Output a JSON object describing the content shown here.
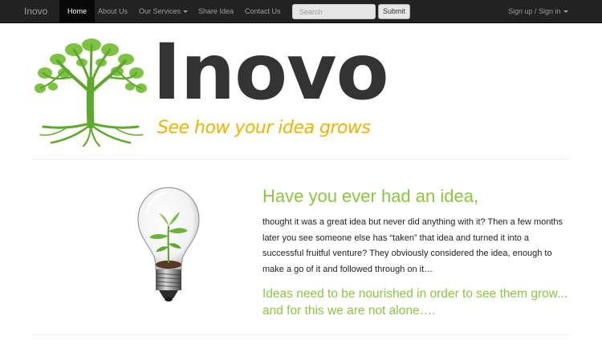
{
  "navbar": {
    "brand": "Inovo",
    "items": [
      {
        "label": "Home"
      },
      {
        "label": "About Us"
      },
      {
        "label": "Our Services"
      },
      {
        "label": "Share Idea"
      },
      {
        "label": "Contact Us"
      }
    ],
    "search_placeholder": "Search",
    "submit_label": "Submit",
    "signin_label": "Sign up / Sign in"
  },
  "hero": {
    "logo_text": "Inovo",
    "tagline": "See how your idea grows"
  },
  "main": {
    "heading": "Have you ever had an idea,",
    "paragraph": "thought it was a great idea but never did anything with it? Then a few months later you see someone else has “taken” that idea and turned it into a successful fruitful venture? They obviously considered the idea, enough to make a go of it and followed through on it…",
    "quote": "Ideas need to be nourished in order to see them grow... and for this we are not alone…."
  },
  "colors": {
    "navbar_bg": "#222222",
    "brand_green": "#8cc63f",
    "tagline_yellow": "#f0b400",
    "logo_dark": "#333333"
  },
  "icons": [
    "tree-logo-icon",
    "lightbulb-plant-icon",
    "caret-down-icon"
  ]
}
